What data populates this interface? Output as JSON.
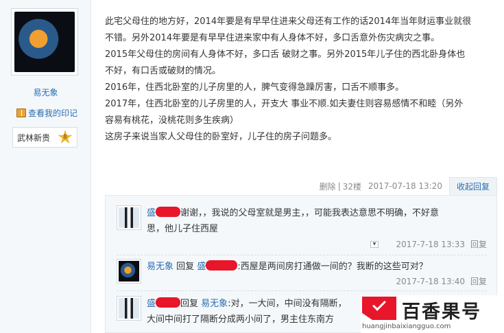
{
  "author": {
    "name": "易无象",
    "seal_link": "查看我的印记",
    "rank": "武林新贵",
    "rank_level": "8"
  },
  "post": {
    "lines": [
      "此宅父母住的地方好，2014年要是有早早住进来父母还有工作的话2014年当年财运事业就很",
      "不错。另外2014年要是有早早住进来家中有人身体不好，多口舌意外伤灾病灾之事。",
      "2015年父母住的房间有人身体不好，多口舌 破财之事。另外2015年儿子住的西北卧身体也",
      "不好，有口舌或破财的情况。",
      "2016年，住西北卧室的儿子房里的人，脾气变得急躁厉害，口舌不顺事多。",
      "2017年，住西北卧室的儿子房里的人，开支大 事业不顺.如夫妻住则容易感情不和睦（另外",
      "容易有桃花，没桃花则多生疾病）",
      "这房子来说当家人父母住的卧室好，儿子住的房子问题多。"
    ],
    "meta": {
      "delete": "删除",
      "floor": "32楼",
      "timestamp": "2017-07-18 13:20",
      "collapse": "收起回复"
    }
  },
  "replies": [
    {
      "user": "盛",
      "line1": "谢谢，，我说的父母室就是男主，，可能我表达意思不明确，不好意",
      "line2": "思，他儿子住西屋",
      "time": "2017-7-18 13:33",
      "reply_label": "回复"
    },
    {
      "user": "易无象",
      "prefix": "回复",
      "target": "盛",
      "text": ":西屋是两间房打通做一间的？我断的这些可对？",
      "time": "2017-7-18 13:40",
      "reply_label": "回复"
    },
    {
      "user": "盛",
      "prefix": "回复",
      "target": "易无象",
      "line1": ":对，一大间，中间没有隔断，",
      "line2": "大间中间打了隔断分成两小间了，男主住东南方"
    }
  ],
  "watermark": {
    "name": "百香果号",
    "domain": "huangjinbaixiangguo.com"
  }
}
